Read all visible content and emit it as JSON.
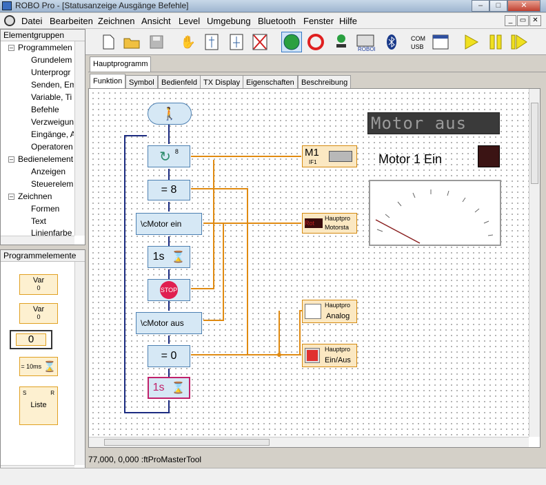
{
  "window": {
    "title": "ROBO Pro - [Statusanzeige Ausgänge Befehle]"
  },
  "menu": [
    "Datei",
    "Bearbeiten",
    "Zeichnen",
    "Ansicht",
    "Level",
    "Umgebung",
    "Bluetooth",
    "Fenster",
    "Hilfe"
  ],
  "left_top": {
    "title": "Elementgruppen",
    "items": [
      "Programmelen",
      "Grundelem",
      "Unterprogr",
      "Senden, Em",
      "Variable, Ti",
      "Befehle",
      "Verzweigun",
      "Eingänge, A",
      "Operatoren",
      "Bedienelement",
      "Anzeigen",
      "Steuerelem",
      "Zeichnen",
      "Formen",
      "Text",
      "Linienfarbe"
    ]
  },
  "left_bottom": {
    "title": "Programmelemente",
    "var1_label": "Var",
    "var1_value": "0",
    "var2_label": "Var",
    "var2_value": "0",
    "zero_value": "0",
    "timer_label": "= 10ms",
    "list_label": "Liste",
    "list_s": "S",
    "list_r": "R"
  },
  "tabs_top": [
    "Hauptprogramm"
  ],
  "tabs_sub": [
    "Funktion",
    "Symbol",
    "Bedienfeld",
    "TX Display",
    "Eigenschaften",
    "Beschreibung"
  ],
  "program": {
    "loop_count": "8",
    "assign_value1": "=  8",
    "text1": "\\cMotor ein",
    "wait1": "1s",
    "stop_label": "STOP",
    "text2": "\\cMotor aus",
    "assign_value2": "=  0",
    "wait2": "1s"
  },
  "io": {
    "motor_label": "M1",
    "motor_sub": "IF1",
    "disp_label1": "Hauptpro",
    "disp_label2": "Motorsta",
    "disp_value": "Rot",
    "analog_label1": "Hauptpro",
    "analog_label2": "Analog",
    "lamp_label1": "Hauptpro",
    "lamp_label2": "Ein/Aus"
  },
  "panel": {
    "lcd_text": "Motor aus",
    "status_text": "Motor 1 Ein"
  },
  "colors": {
    "lamp": "#3b1414",
    "lcd_bg": "#3a3a3a",
    "lcd_text": "#9a9a9a",
    "wire": "#e08a10",
    "flow": "#1a2a80"
  },
  "status": "77,000, 0,000 :ftProMasterTool"
}
